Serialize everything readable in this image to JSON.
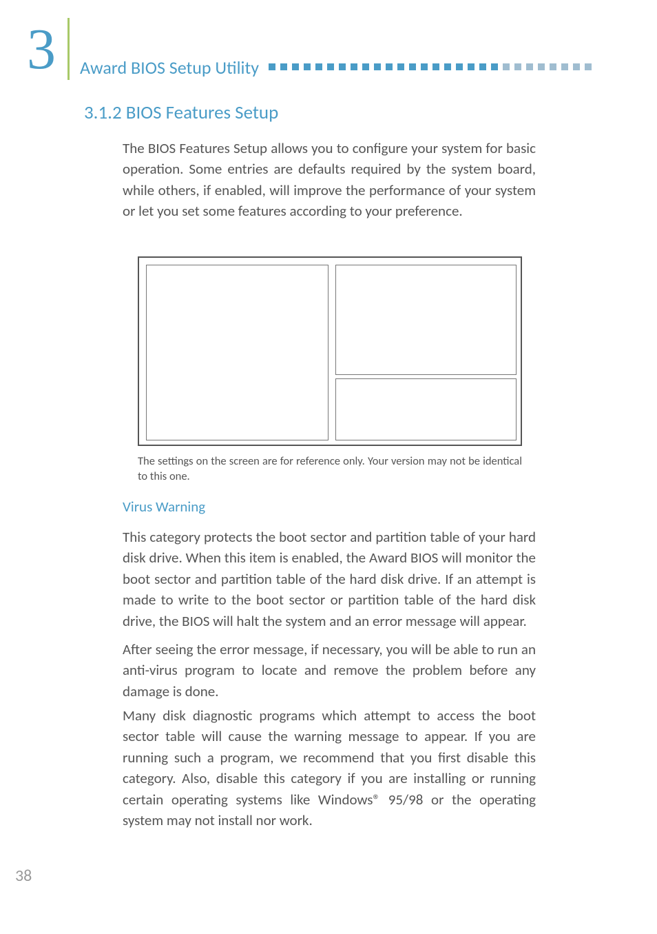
{
  "chapter": {
    "number": "3",
    "title": "Award BIOS Setup Utility"
  },
  "section": {
    "heading": "3.1.2  BIOS Features Setup"
  },
  "paragraphs": {
    "intro": "The BIOS Features Setup allows you to configure your system for basic operation. Some entries are defaults required by the system board, while others, if enabled, will improve the performance of your system or let you set some features according to your preference.",
    "figure_caption": "The settings on the screen are for reference only. Your version may not be identical to this one.",
    "sub_heading": "Virus Warning",
    "virus1": "This category protects the boot sector and partition table of your hard disk drive. When this item is enabled, the Award BIOS will monitor the boot sector and partition table of the hard disk drive. If an attempt is made to write to the boot sector or partition table of the hard disk drive, the BIOS will halt the system and an error message will appear.",
    "virus2": "After seeing the error message, if necessary, you will be able to run an anti-virus program to locate and remove the problem before any damage is done.",
    "virus3": "Many disk diagnostic programs which attempt to access the boot sector table will cause the warning message to appear. If you are running such a program, we recommend that you first disable this category. Also, disable this category if you are installing or running certain operating systems like Windows® 95/98 or the operating system may not install nor work."
  },
  "page_number": "38"
}
